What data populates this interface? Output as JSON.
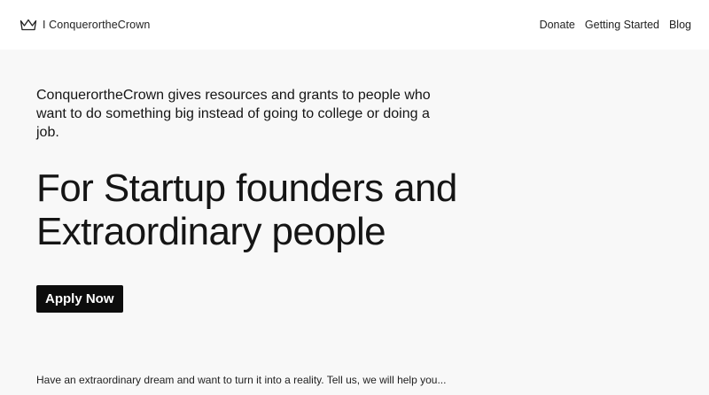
{
  "header": {
    "brand_name": "I ConquerortheCrown",
    "nav": [
      "Donate",
      "Getting Started",
      "Blog"
    ]
  },
  "hero": {
    "intro": "ConquerortheCrown gives resources and grants to people who want to do something big instead of going to college or doing a job.",
    "headline_line1": "For Startup founders and",
    "headline_line2": "Extraordinary people",
    "cta_label": "Apply Now"
  },
  "footer": {
    "tagline": "Have an extraordinary dream and want to turn it into a reality. Tell us, we will help you..."
  },
  "icons": {
    "logo": "crown-icon"
  },
  "colors": {
    "page_bg": "#f8f8f8",
    "header_bg": "#ffffff",
    "button_bg": "#0d0d0d",
    "button_text": "#ffffff"
  }
}
